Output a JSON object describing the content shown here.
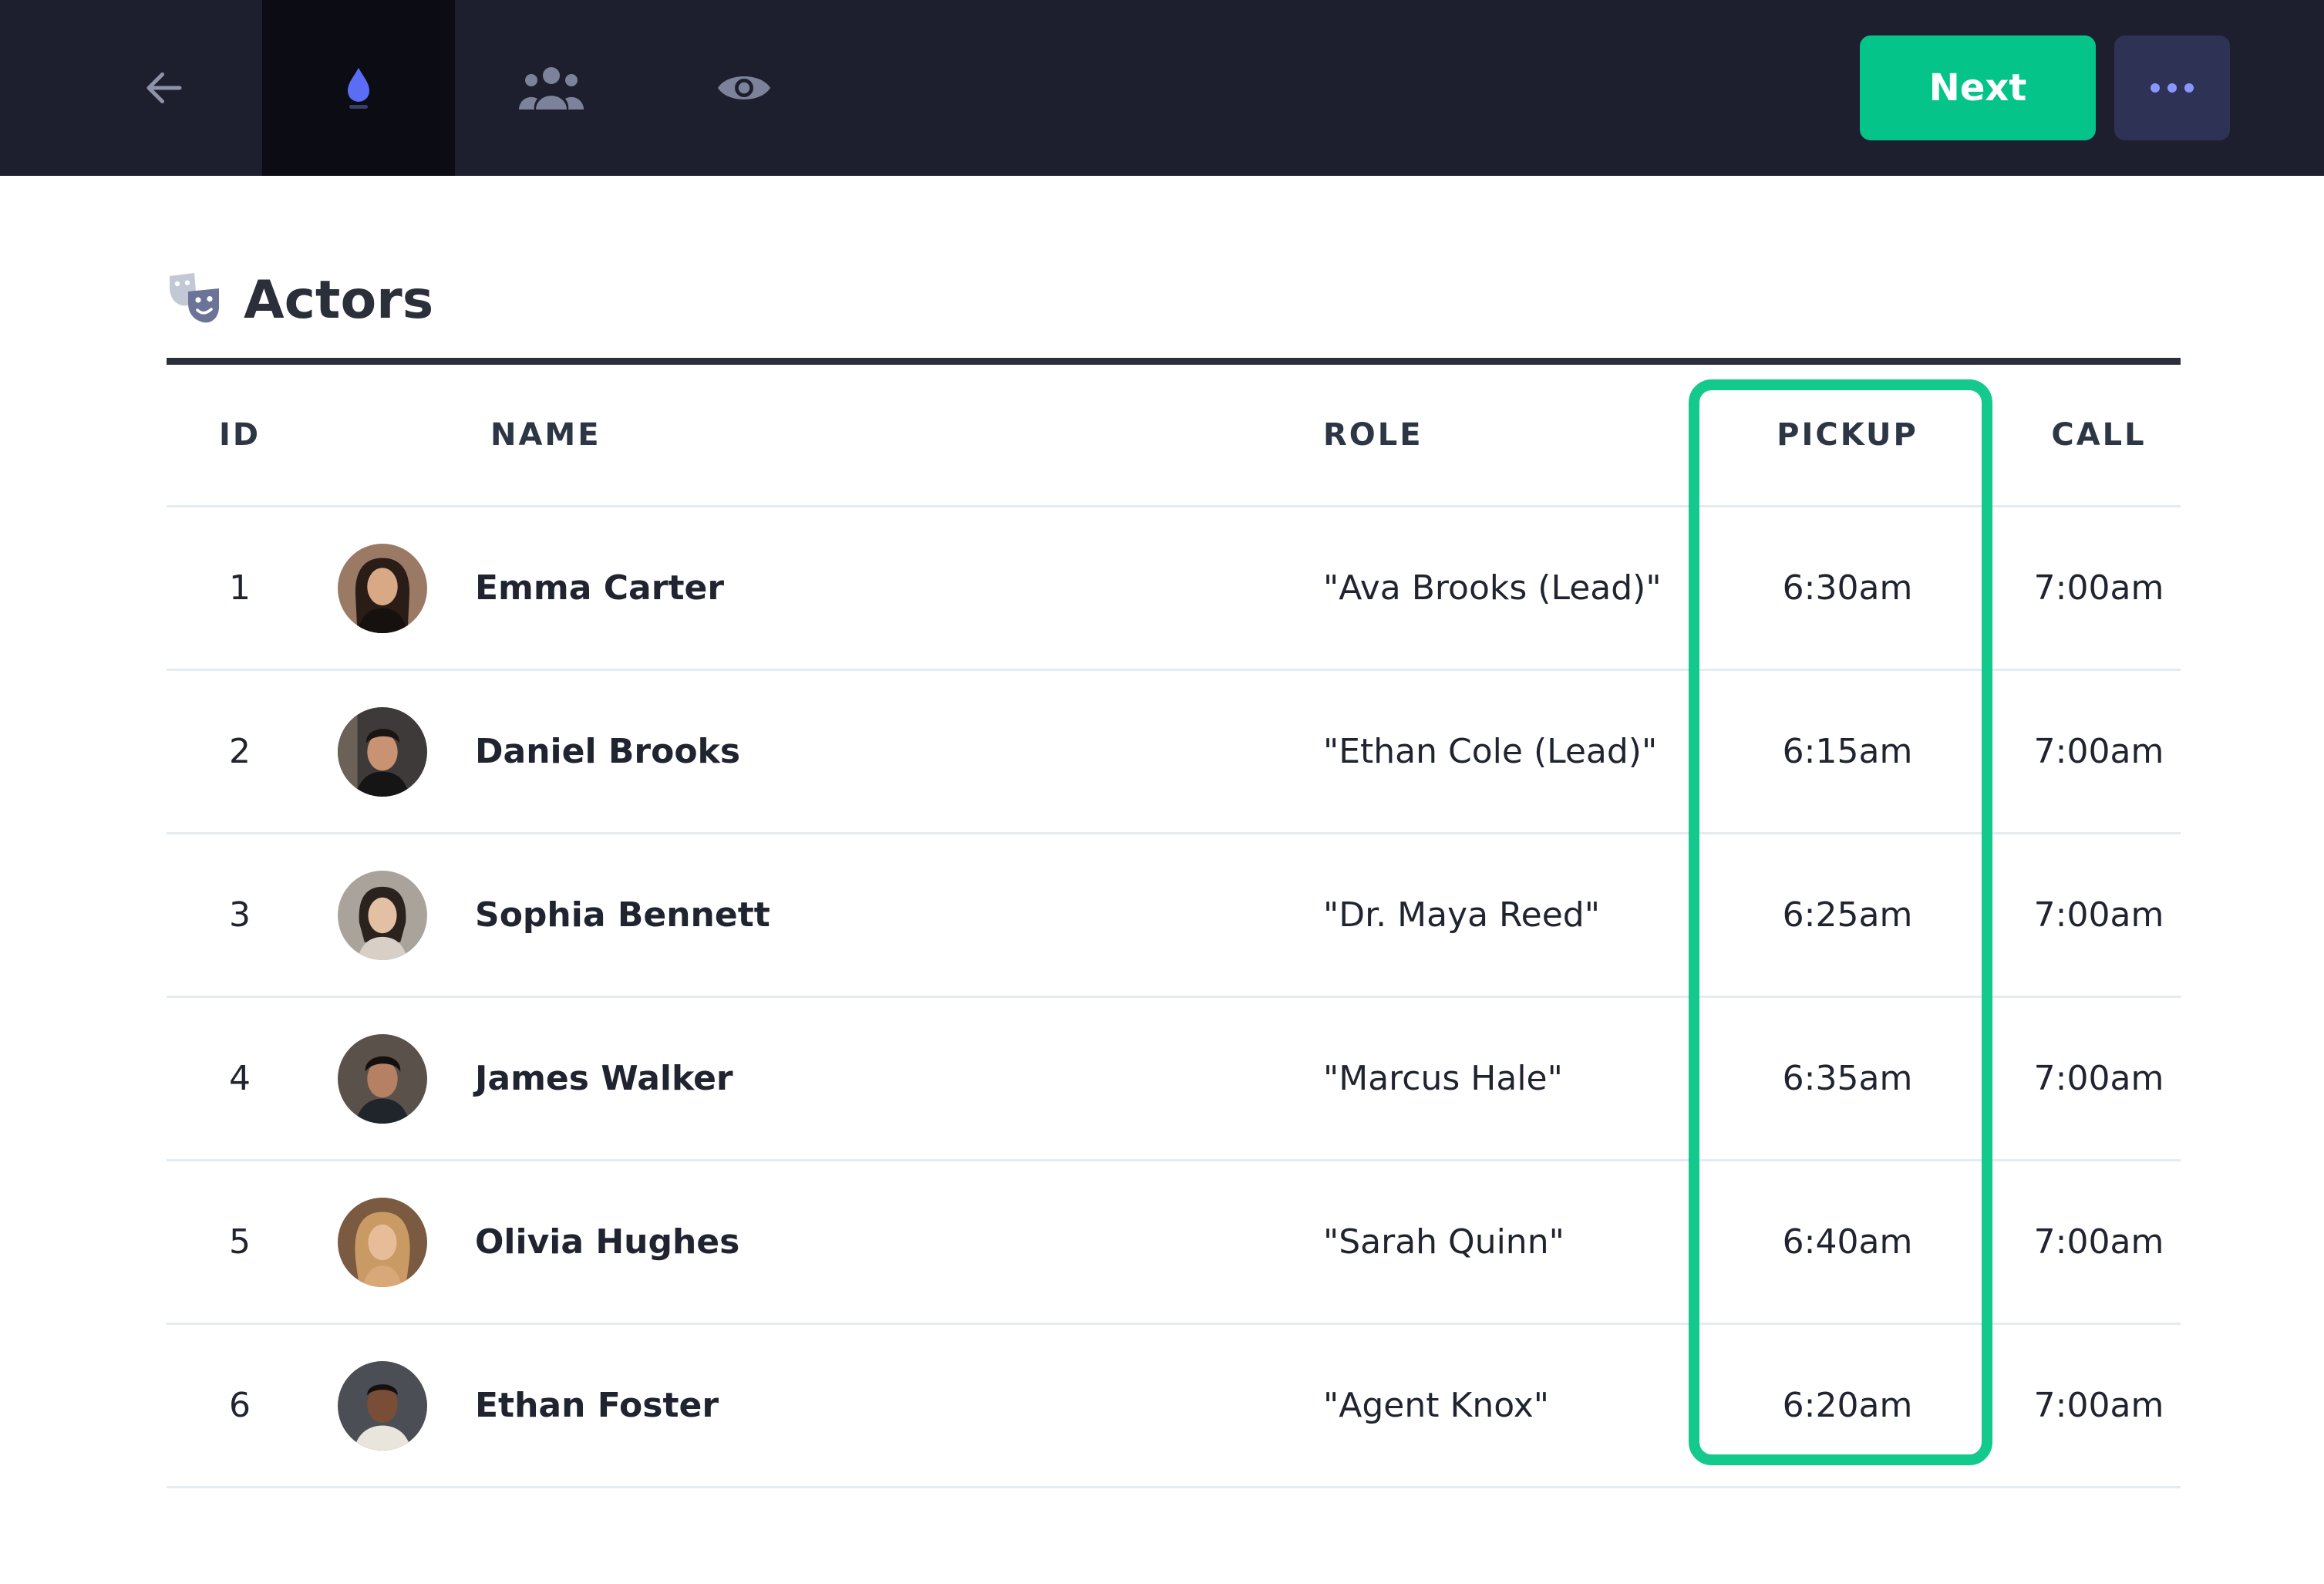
{
  "topbar": {
    "icons": {
      "back": "arrow-left-icon",
      "flame": "flame-icon",
      "team": "team-icon",
      "view": "eye-icon",
      "more": "more-dots-icon"
    },
    "next_label": "Next",
    "colors": {
      "background": "#1e1f2e",
      "active_tab": "#0c0c14",
      "next_button": "#05c48a",
      "more_button": "#2e3356",
      "accent": "#5b6cf5"
    }
  },
  "section": {
    "title": "Actors",
    "icon": "theater-masks-icon"
  },
  "table": {
    "columns": [
      "ID",
      "NAME",
      "ROLE",
      "PICKUP",
      "CALL"
    ],
    "rows": [
      {
        "id": "1",
        "name": "Emma Carter",
        "role": "\"Ava Brooks (Lead)\"",
        "pickup": "6:30am",
        "call": "7:00am",
        "avatar": "avatar-emma-carter"
      },
      {
        "id": "2",
        "name": "Daniel Brooks",
        "role": "\"Ethan Cole (Lead)\"",
        "pickup": "6:15am",
        "call": "7:00am",
        "avatar": "avatar-daniel-brooks"
      },
      {
        "id": "3",
        "name": "Sophia Bennett",
        "role": "\"Dr. Maya Reed\"",
        "pickup": "6:25am",
        "call": "7:00am",
        "avatar": "avatar-sophia-bennett"
      },
      {
        "id": "4",
        "name": "James Walker",
        "role": "\"Marcus Hale\"",
        "pickup": "6:35am",
        "call": "7:00am",
        "avatar": "avatar-james-walker"
      },
      {
        "id": "5",
        "name": "Olivia Hughes",
        "role": "\"Sarah Quinn\"",
        "pickup": "6:40am",
        "call": "7:00am",
        "avatar": "avatar-olivia-hughes"
      },
      {
        "id": "6",
        "name": "Ethan Foster",
        "role": "\"Agent Knox\"",
        "pickup": "6:20am",
        "call": "7:00am",
        "avatar": "avatar-ethan-foster"
      }
    ],
    "highlight_color": "#14c98c"
  }
}
